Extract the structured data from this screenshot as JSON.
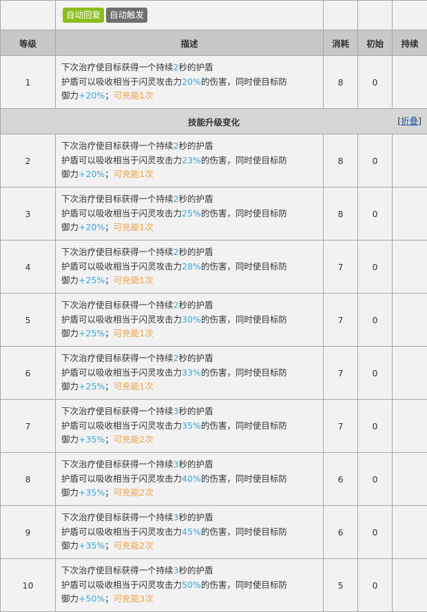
{
  "tags": [
    {
      "label": "自动回复",
      "color": "#8cbe1e"
    },
    {
      "label": "自动触发",
      "color": "#6e6e6e"
    }
  ],
  "headers": {
    "level": "等级",
    "desc": "描述",
    "cost": "消耗",
    "initial": "初始",
    "duration": "持续"
  },
  "section": {
    "title": "技能升级变化",
    "fold_open": "[",
    "fold_label": "折叠",
    "fold_close": "]"
  },
  "desc_parts": {
    "l1a": "下次治疗使目标获得一个持续",
    "l1b": "秒的护盾",
    "l2a": "护盾可以吸收相当于闪灵攻击力",
    "l2b": "的伤害，同时使目标防",
    "l3a": "御力",
    "l3b": "；"
  },
  "rows": [
    {
      "level": "1",
      "seconds": "2",
      "pct": "20%",
      "def": "+20%",
      "charge": "可充能1次",
      "cost": "8",
      "initial": "0",
      "duration": ""
    },
    {
      "level": "2",
      "seconds": "2",
      "pct": "23%",
      "def": "+20%",
      "charge": "可充能1次",
      "cost": "8",
      "initial": "0",
      "duration": ""
    },
    {
      "level": "3",
      "seconds": "2",
      "pct": "25%",
      "def": "+20%",
      "charge": "可充能1次",
      "cost": "8",
      "initial": "0",
      "duration": ""
    },
    {
      "level": "4",
      "seconds": "2",
      "pct": "28%",
      "def": "+25%",
      "charge": "可充能1次",
      "cost": "7",
      "initial": "0",
      "duration": ""
    },
    {
      "level": "5",
      "seconds": "2",
      "pct": "30%",
      "def": "+25%",
      "charge": "可充能1次",
      "cost": "7",
      "initial": "0",
      "duration": ""
    },
    {
      "level": "6",
      "seconds": "2",
      "pct": "33%",
      "def": "+25%",
      "charge": "可充能1次",
      "cost": "7",
      "initial": "0",
      "duration": ""
    },
    {
      "level": "7",
      "seconds": "3",
      "pct": "35%",
      "def": "+35%",
      "charge": "可充能2次",
      "cost": "7",
      "initial": "0",
      "duration": ""
    },
    {
      "level": "8",
      "seconds": "3",
      "pct": "40%",
      "def": "+35%",
      "charge": "可充能2次",
      "cost": "6",
      "initial": "0",
      "duration": ""
    },
    {
      "level": "9",
      "seconds": "3",
      "pct": "45%",
      "def": "+35%",
      "charge": "可充能2次",
      "cost": "6",
      "initial": "0",
      "duration": ""
    },
    {
      "level": "10",
      "seconds": "3",
      "pct": "50%",
      "def": "+50%",
      "charge": "可充能3次",
      "cost": "5",
      "initial": "0",
      "duration": ""
    }
  ]
}
